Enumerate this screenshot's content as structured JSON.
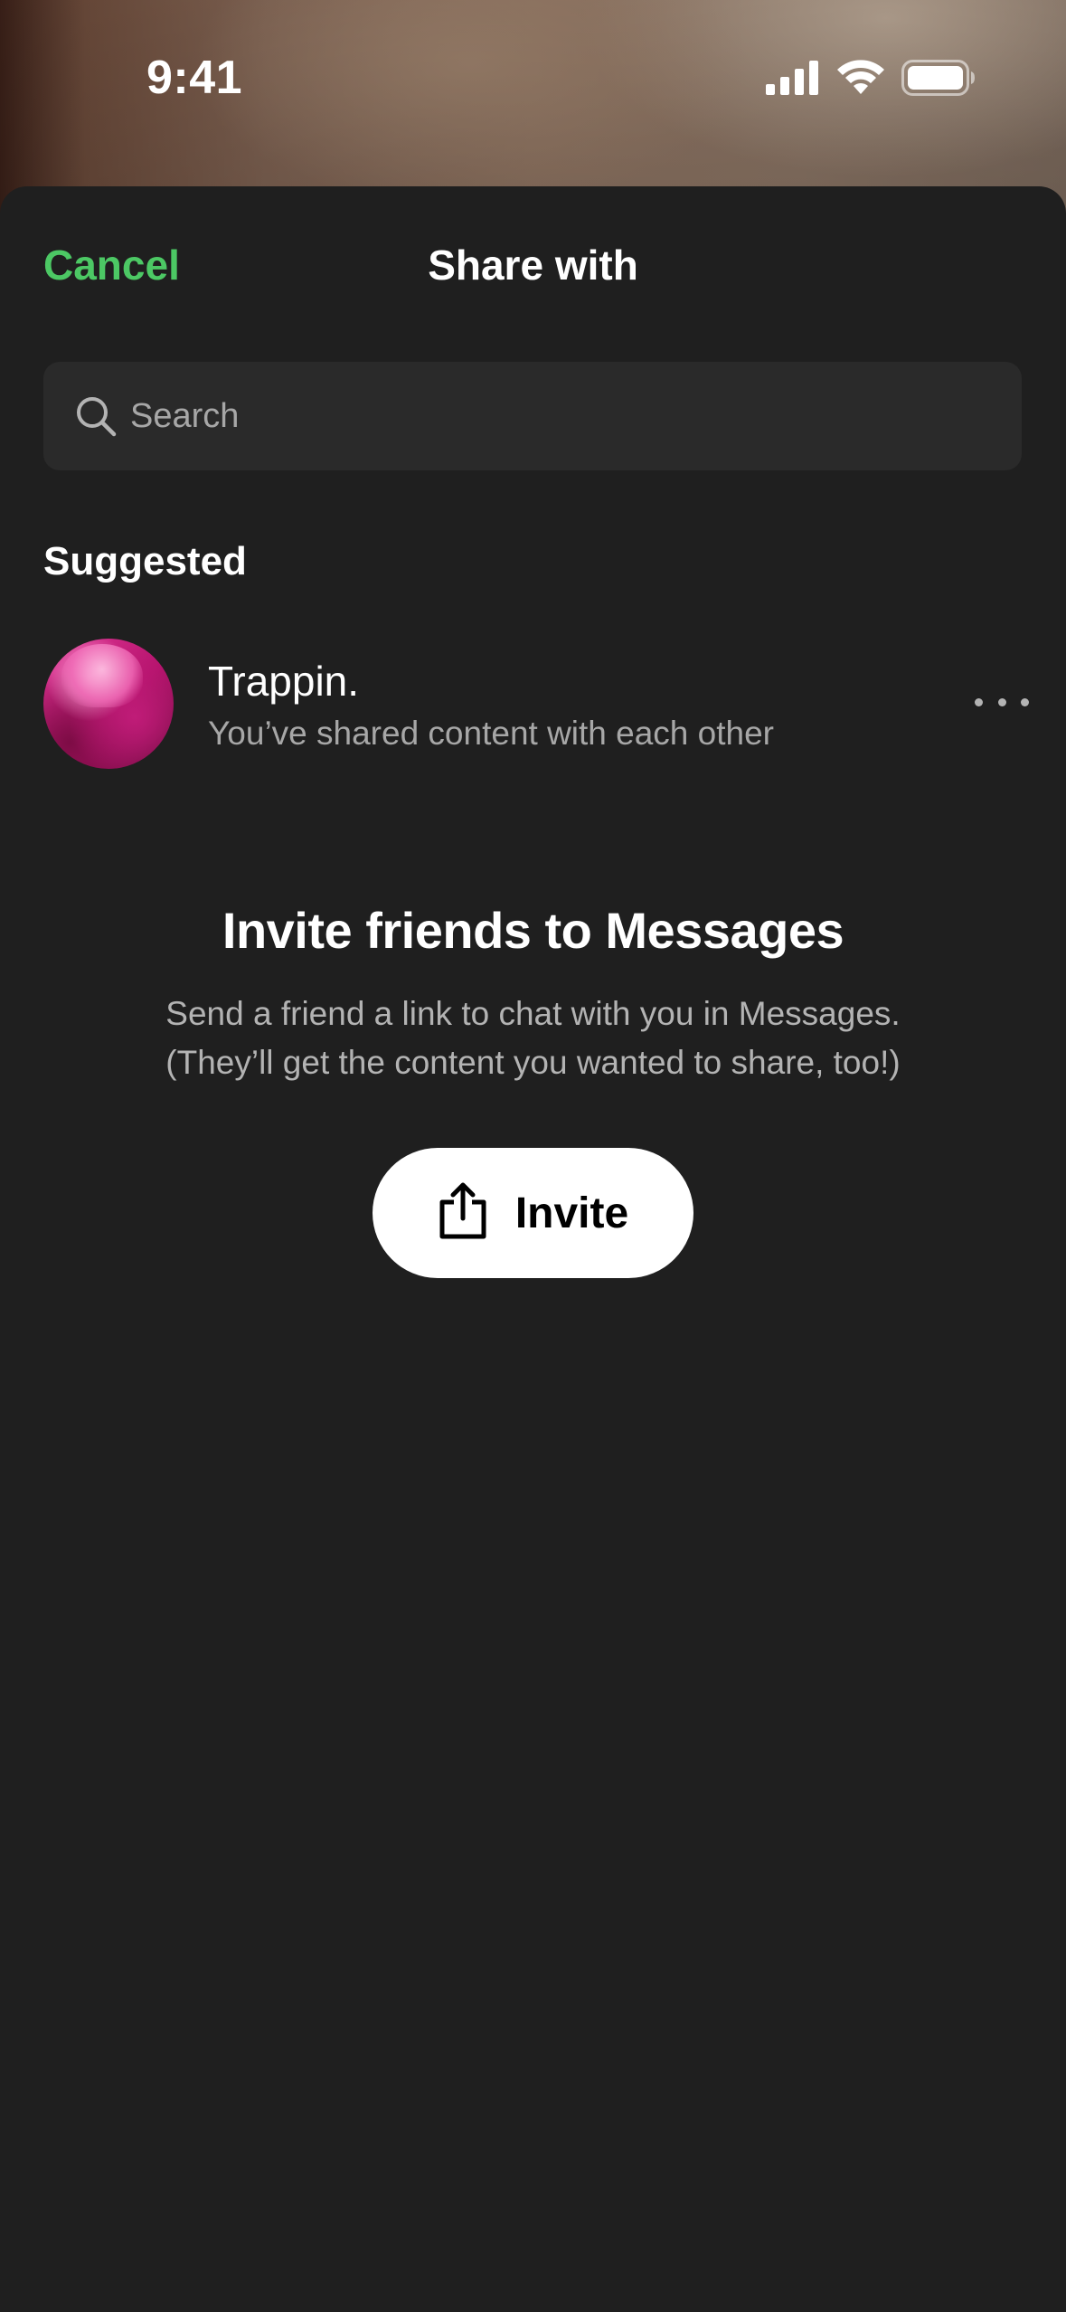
{
  "status_bar": {
    "time": "9:41",
    "icons": [
      "cellular-signal-icon",
      "wifi-icon",
      "battery-icon"
    ]
  },
  "header": {
    "cancel_label": "Cancel",
    "title": "Share with"
  },
  "search": {
    "placeholder": "Search",
    "value": ""
  },
  "suggested": {
    "heading": "Suggested",
    "contacts": [
      {
        "name": "Trappin.",
        "subtitle": "You’ve shared content with each other"
      }
    ]
  },
  "invite": {
    "title": "Invite friends to Messages",
    "description_line1": "Send a friend a link to chat with you in Messages.",
    "description_line2": "(They’ll get the content you wanted to share, too!)",
    "button_label": "Invite"
  },
  "colors": {
    "accent": "#4cc864",
    "sheet_background": "#1f1f1f",
    "search_background": "#2a2a2a",
    "secondary_text": "#a7a7a7"
  }
}
